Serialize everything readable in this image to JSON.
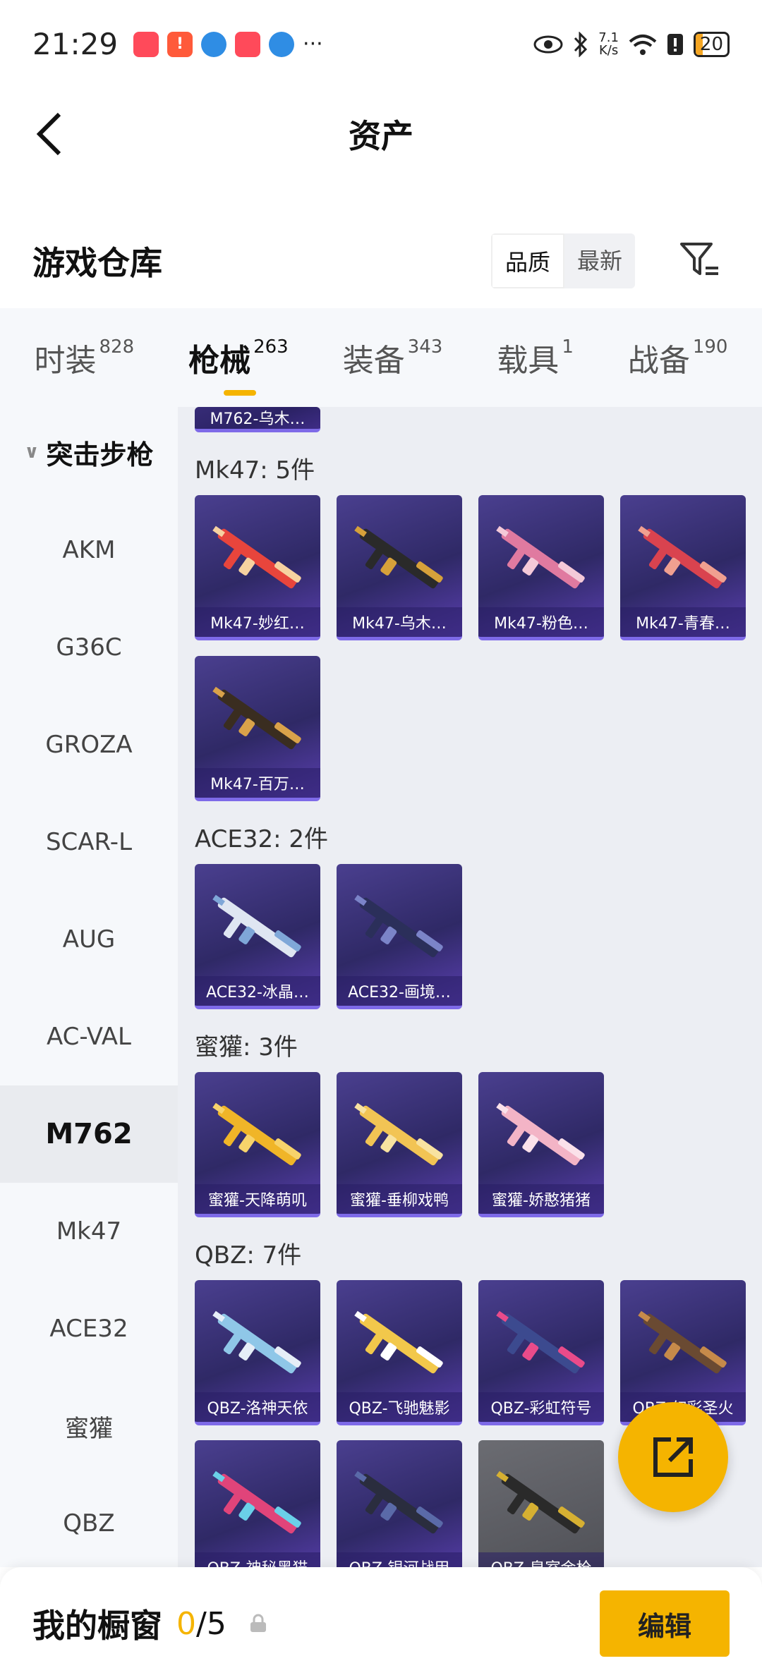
{
  "status_bar": {
    "time": "21:29",
    "speed_value": "7.1",
    "speed_unit": "K/s",
    "battery": "20",
    "more": "···"
  },
  "header": {
    "title": "资产"
  },
  "warehouse": {
    "title": "游戏仓库",
    "sort_options": [
      "品质",
      "最新"
    ]
  },
  "tabs": [
    {
      "label": "时装",
      "count": "828"
    },
    {
      "label": "枪械",
      "count": "263"
    },
    {
      "label": "装备",
      "count": "343"
    },
    {
      "label": "载具",
      "count": "1"
    },
    {
      "label": "战备",
      "count": "190"
    }
  ],
  "sidebar": {
    "category": "突击步枪",
    "items": [
      "AKM",
      "G36C",
      "GROZA",
      "SCAR-L",
      "AUG",
      "AC-VAL",
      "M762",
      "Mk47",
      "ACE32",
      "蜜獾",
      "QBZ"
    ]
  },
  "groups": [
    {
      "title": "Mk47: 5件",
      "items": [
        "Mk47-妙红…",
        "Mk47-乌木…",
        "Mk47-粉色…",
        "Mk47-青春…",
        "Mk47-百万…"
      ]
    },
    {
      "title": "ACE32: 2件",
      "items": [
        "ACE32-冰晶…",
        "ACE32-画境…"
      ]
    },
    {
      "title": "蜜獾: 3件",
      "items": [
        "蜜獾-天降萌叽",
        "蜜獾-垂柳戏鸭",
        "蜜獾-娇憨猪猪"
      ]
    },
    {
      "title": "QBZ: 7件",
      "items": [
        "QBZ-洛神天依",
        "QBZ-飞驰魅影",
        "QBZ-彩虹符号",
        "QBZ-幻彩圣火",
        "QBZ-神秘黑猫",
        "QBZ-银河战甲",
        "QBZ-皇室金枪"
      ]
    }
  ],
  "top_partial_item": "M762-乌木…",
  "bottom_bar": {
    "title": "我的橱窗",
    "current": "0",
    "total": "/5",
    "edit_label": "编辑"
  },
  "colors": {
    "accent": "#f5b400",
    "card_bg": "#2f2966"
  }
}
